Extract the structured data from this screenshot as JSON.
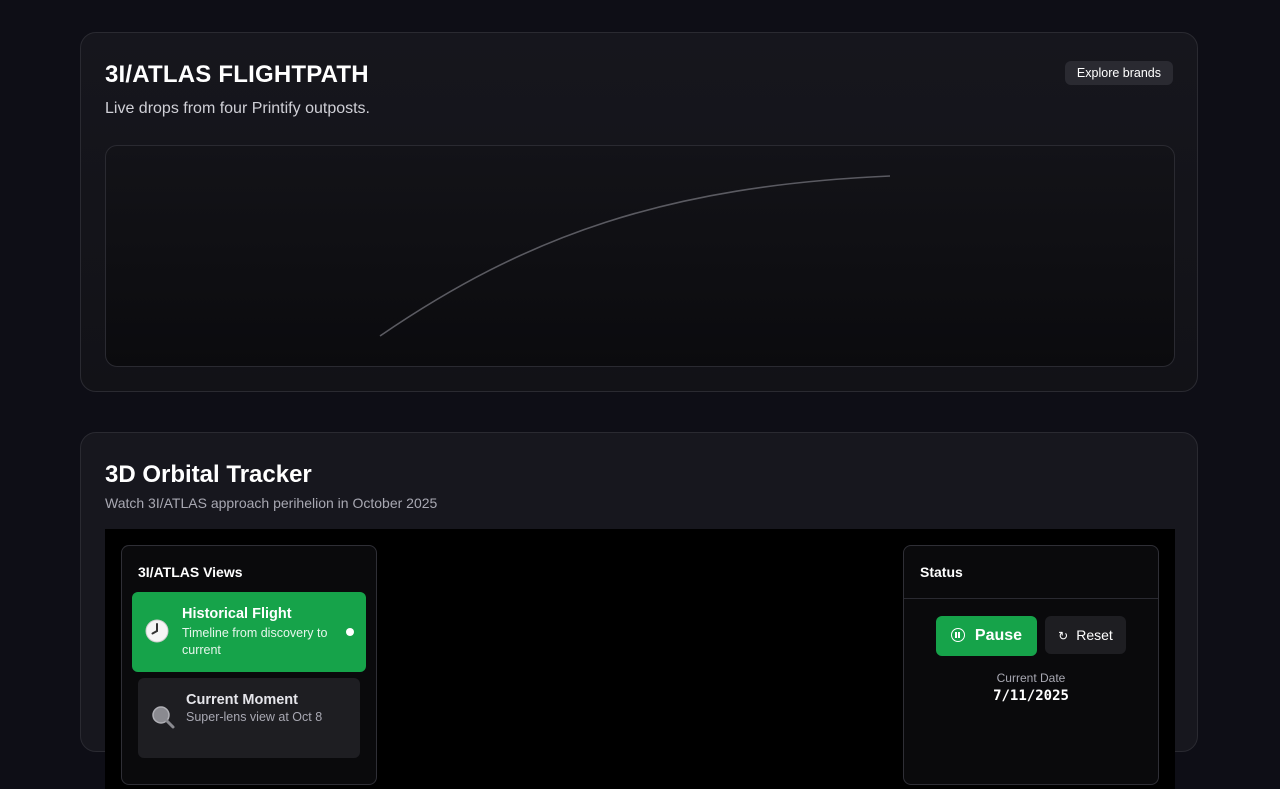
{
  "flightpath": {
    "title": "3I/ATLAS FLIGHTPATH",
    "subtitle": "Live drops from four Printify outposts.",
    "explore_label": "Explore brands",
    "path_color": "#5a5a61"
  },
  "tracker": {
    "title": "3D Orbital Tracker",
    "subtitle": "Watch 3I/ATLAS approach perihelion in October 2025",
    "views": {
      "title": "3I/ATLAS Views",
      "items": [
        {
          "name": "Historical Flight",
          "desc": "Timeline from discovery to current",
          "icon": "clock-icon",
          "active": true
        },
        {
          "name": "Current Moment",
          "desc": "Super-lens view at Oct 8",
          "icon": "magnifier-icon",
          "active": false
        }
      ]
    },
    "status": {
      "title": "Status",
      "pause_label": "Pause",
      "reset_label": "Reset",
      "date_label": "Current Date",
      "date_value": "7/11/2025"
    }
  },
  "colors": {
    "accent": "#16a34a",
    "background": "#0e0e16",
    "card": "#16161d"
  }
}
